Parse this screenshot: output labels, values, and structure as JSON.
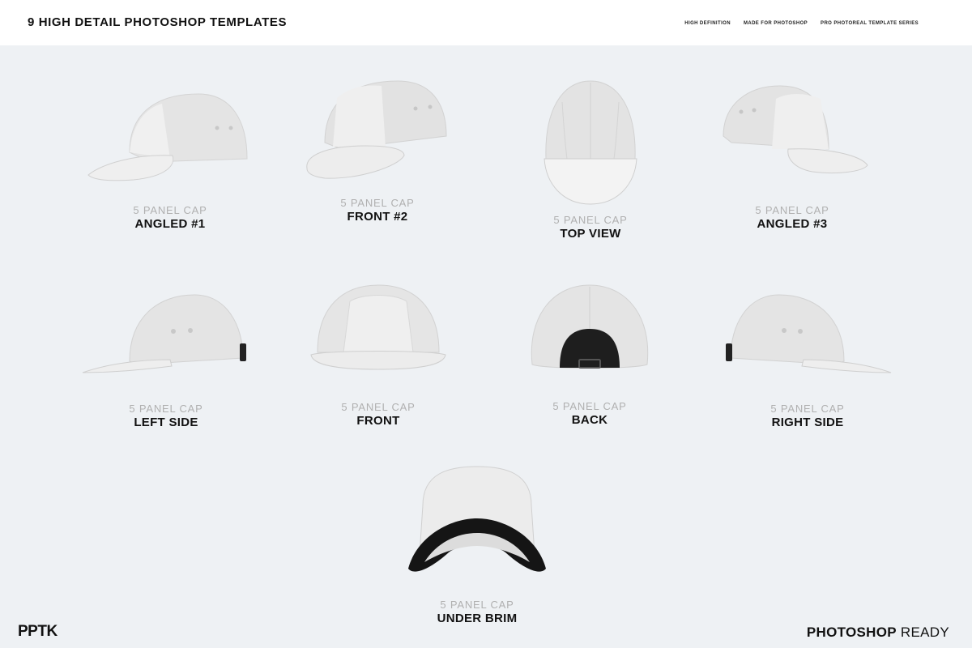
{
  "header": {
    "title": "9 HIGH DETAIL PHOTOSHOP TEMPLATES",
    "tags": [
      "HIGH DEFINITION",
      "MADE FOR PHOTOSHOP",
      "PRO PHOTOREAL TEMPLATE SERIES"
    ]
  },
  "caps": [
    {
      "subtitle": "5 PANEL CAP",
      "name": "ANGLED #1"
    },
    {
      "subtitle": "5 PANEL CAP",
      "name": "FRONT #2"
    },
    {
      "subtitle": "5 PANEL CAP",
      "name": "TOP VIEW"
    },
    {
      "subtitle": "5 PANEL CAP",
      "name": "ANGLED #3"
    },
    {
      "subtitle": "5 PANEL CAP",
      "name": "LEFT SIDE"
    },
    {
      "subtitle": "5 PANEL CAP",
      "name": "FRONT"
    },
    {
      "subtitle": "5 PANEL CAP",
      "name": "BACK"
    },
    {
      "subtitle": "5 PANEL CAP",
      "name": "RIGHT SIDE"
    },
    {
      "subtitle": "5 PANEL CAP",
      "name": "UNDER BRIM"
    }
  ],
  "footer": {
    "logo": "PPTK",
    "ready_bold": "PHOTOSHOP",
    "ready_rest": "READY"
  },
  "colors": {
    "background": "#eef1f4",
    "header_bg": "#ffffff",
    "cap_fill": "#e6e6e6",
    "subtitle": "#b0b0b0",
    "text": "#111111"
  }
}
